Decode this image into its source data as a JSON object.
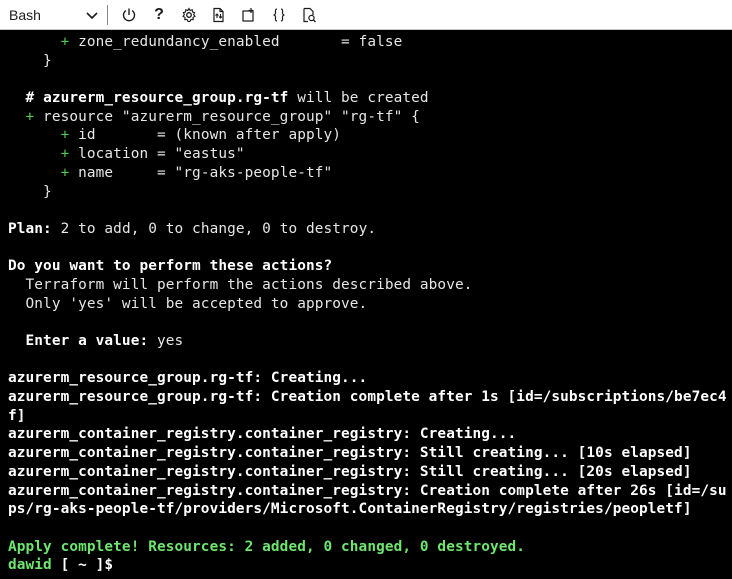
{
  "toolbar": {
    "shell": "Bash",
    "icons": [
      "power-icon",
      "help-icon",
      "settings-icon",
      "upload-download-icon",
      "open-new-session-icon",
      "editor-braces-icon",
      "web-preview-icon"
    ],
    "help_glyph": "?"
  },
  "terminal": {
    "lines": [
      [
        {
          "t": "      "
        },
        {
          "t": "+",
          "c": "g"
        },
        {
          "t": " zone_redundancy_enabled       = false"
        }
      ],
      [
        {
          "t": "    }"
        }
      ],
      [
        {
          "t": ""
        }
      ],
      [
        {
          "t": "  "
        },
        {
          "t": "#",
          "c": "b"
        },
        {
          "t": " "
        },
        {
          "t": "azurerm_resource_group.rg-tf",
          "c": "b"
        },
        {
          "t": " will be created"
        }
      ],
      [
        {
          "t": "  "
        },
        {
          "t": "+",
          "c": "g"
        },
        {
          "t": " resource \"azurerm_resource_group\" \"rg-tf\" {"
        }
      ],
      [
        {
          "t": "      "
        },
        {
          "t": "+",
          "c": "g"
        },
        {
          "t": " id       = (known after apply)"
        }
      ],
      [
        {
          "t": "      "
        },
        {
          "t": "+",
          "c": "g"
        },
        {
          "t": " location = \"eastus\""
        }
      ],
      [
        {
          "t": "      "
        },
        {
          "t": "+",
          "c": "g"
        },
        {
          "t": " name     = \"rg-aks-people-tf\""
        }
      ],
      [
        {
          "t": "    }"
        }
      ],
      [
        {
          "t": ""
        }
      ],
      [
        {
          "t": "Plan:",
          "c": "b"
        },
        {
          "t": " 2 to add, 0 to change, 0 to destroy."
        }
      ],
      [
        {
          "t": ""
        }
      ],
      [
        {
          "t": "Do you want to perform these actions?",
          "c": "b"
        }
      ],
      [
        {
          "t": "  Terraform will perform the actions described above."
        }
      ],
      [
        {
          "t": "  Only 'yes' will be accepted to approve."
        }
      ],
      [
        {
          "t": ""
        }
      ],
      [
        {
          "t": "  "
        },
        {
          "t": "Enter a value:",
          "c": "b"
        },
        {
          "t": " yes"
        }
      ],
      [
        {
          "t": ""
        }
      ],
      [
        {
          "t": "azurerm_resource_group.rg-tf: Creating...",
          "c": "b"
        }
      ],
      [
        {
          "t": "azurerm_resource_group.rg-tf: Creation complete after 1s [id=/subscriptions/be7ec4",
          "c": "b"
        }
      ],
      [
        {
          "t": "f]",
          "c": "b"
        }
      ],
      [
        {
          "t": "azurerm_container_registry.container_registry: Creating...",
          "c": "b"
        }
      ],
      [
        {
          "t": "azurerm_container_registry.container_registry: Still creating... [10s elapsed]",
          "c": "b"
        }
      ],
      [
        {
          "t": "azurerm_container_registry.container_registry: Still creating... [20s elapsed]",
          "c": "b"
        }
      ],
      [
        {
          "t": "azurerm_container_registry.container_registry: Creation complete after 26s [id=/su",
          "c": "b"
        }
      ],
      [
        {
          "t": "ps/rg-aks-people-tf/providers/Microsoft.ContainerRegistry/registries/peopletf]",
          "c": "b"
        }
      ],
      [
        {
          "t": ""
        }
      ],
      [
        {
          "t": "Apply complete! Resources: 2 added, 0 changed, 0 destroyed.",
          "c": "ok"
        }
      ],
      [
        {
          "t": "dawid",
          "c": "prompt-name"
        },
        {
          "t": " [ ~ ]$ ",
          "c": "b"
        }
      ]
    ]
  }
}
